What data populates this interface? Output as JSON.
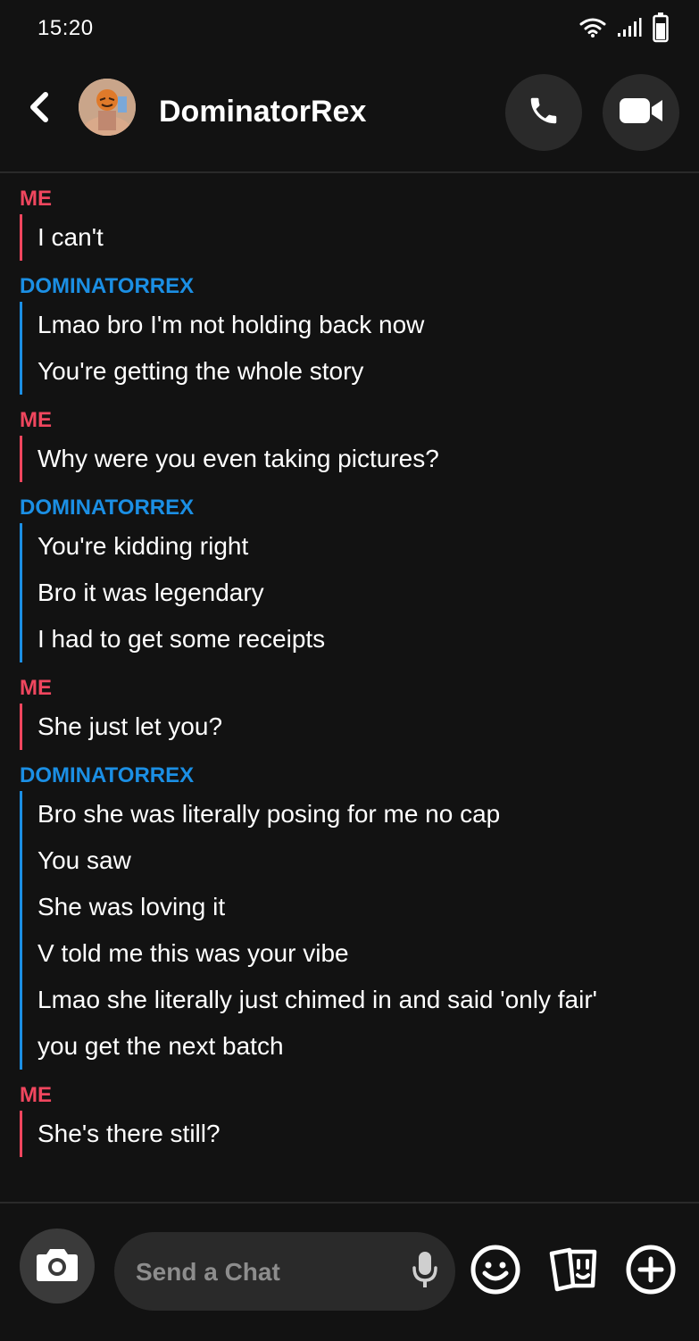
{
  "status_bar": {
    "time": "15:20"
  },
  "header": {
    "contact_name": "DominatorRex"
  },
  "messages": [
    {
      "sender": "ME",
      "side": "me",
      "lines": [
        "I can't"
      ]
    },
    {
      "sender": "DOMINATORREX",
      "side": "friend",
      "lines": [
        "Lmao bro I'm not holding back now",
        "You're getting the whole story"
      ]
    },
    {
      "sender": "ME",
      "side": "me",
      "lines": [
        "Why were you even taking pictures?"
      ]
    },
    {
      "sender": "DOMINATORREX",
      "side": "friend",
      "lines": [
        "You're kidding right",
        "Bro it was legendary",
        "I had to get some receipts"
      ]
    },
    {
      "sender": "ME",
      "side": "me",
      "lines": [
        "She just let you?"
      ]
    },
    {
      "sender": "DOMINATORREX",
      "side": "friend",
      "lines": [
        "Bro she was literally posing for me no cap",
        "You saw",
        "She was loving it",
        "V told me this was your vibe",
        "Lmao she literally just chimed in and said 'only fair'",
        "you get the next batch"
      ]
    },
    {
      "sender": "ME",
      "side": "me",
      "lines": [
        "She's there still?"
      ]
    }
  ],
  "composer": {
    "placeholder": "Send a Chat"
  },
  "colors": {
    "me": "#f0465e",
    "friend": "#1b8fe4",
    "background": "#121212",
    "button": "#2a2a2a"
  },
  "icons": [
    "wifi-icon",
    "signal-icon",
    "battery-icon",
    "back-arrow-icon",
    "phone-icon",
    "video-camera-icon",
    "camera-icon",
    "microphone-icon",
    "smiley-icon",
    "stickers-icon",
    "plus-icon"
  ]
}
